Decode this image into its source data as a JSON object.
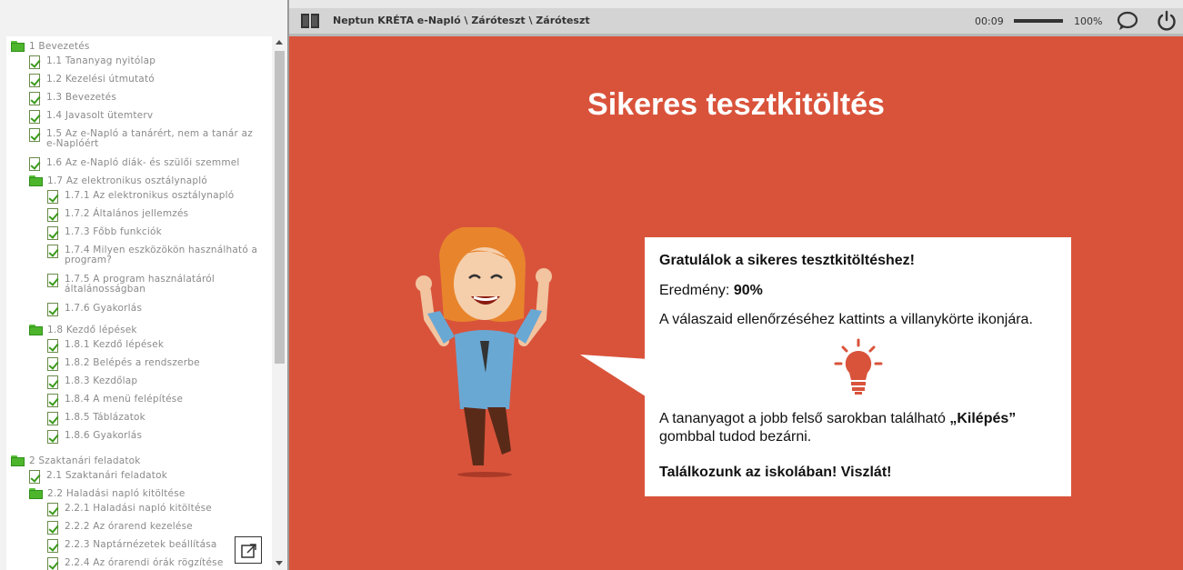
{
  "header": {
    "breadcrumb": "Neptun KRÉTA e-Napló \\ Záróteszt \\ Záróteszt",
    "time": "00:09",
    "volume_percent": "100%",
    "volume_level": 1.0
  },
  "toc": [
    {
      "label": "1 Bevezetés",
      "kind": "folder"
    },
    {
      "label": "1.1 Tananyag nyitólap",
      "kind": "check"
    },
    {
      "label": "1.2 Kezelési útmutató",
      "kind": "check"
    },
    {
      "label": "1.3 Bevezetés",
      "kind": "check"
    },
    {
      "label": "1.4 Javasolt ütemterv",
      "kind": "check"
    },
    {
      "label": "1.5 Az e-Napló a tanárért, nem a tanár az e-Naplóért",
      "kind": "check"
    },
    {
      "label": "1.6 Az e-Napló diák- és szülői szemmel",
      "kind": "check"
    },
    {
      "label": "1.7 Az elektronikus osztálynapló",
      "kind": "folder"
    },
    {
      "label": "1.7.1 Az elektronikus osztálynapló",
      "kind": "check"
    },
    {
      "label": "1.7.2 Általános jellemzés",
      "kind": "check"
    },
    {
      "label": "1.7.3 Főbb funkciók",
      "kind": "check"
    },
    {
      "label": "1.7.4 Milyen eszközökön használható a program?",
      "kind": "check"
    },
    {
      "label": "1.7.5 A program használatáról általánosságban",
      "kind": "check"
    },
    {
      "label": "1.7.6 Gyakorlás",
      "kind": "check"
    },
    {
      "label": "1.8 Kezdő lépések",
      "kind": "folder"
    },
    {
      "label": "1.8.1 Kezdő lépések",
      "kind": "check"
    },
    {
      "label": "1.8.2 Belépés a rendszerbe",
      "kind": "check"
    },
    {
      "label": "1.8.3 Kezdőlap",
      "kind": "check"
    },
    {
      "label": "1.8.4 A menü felépítése",
      "kind": "check"
    },
    {
      "label": "1.8.5 Táblázatok",
      "kind": "check"
    },
    {
      "label": "1.8.6 Gyakorlás",
      "kind": "check"
    },
    {
      "label": "2 Szaktanári feladatok",
      "kind": "folder"
    },
    {
      "label": "2.1 Szaktanári feladatok",
      "kind": "check"
    },
    {
      "label": "2.2 Haladási napló kitöltése",
      "kind": "folder"
    },
    {
      "label": "2.2.1 Haladási napló kitöltése",
      "kind": "check"
    },
    {
      "label": "2.2.2 Az órarend kezelése",
      "kind": "check"
    },
    {
      "label": "2.2.3 Naptárnézetek beállítása",
      "kind": "check"
    },
    {
      "label": "2.2.4 Az órarendi órák rögzítése",
      "kind": "check"
    }
  ],
  "slide": {
    "heading": "Sikeres tesztkitöltés",
    "congrats": "Gratulálok a sikeres tesztkitöltéshez!",
    "result_label": "Eredmény:",
    "result_value": "90%",
    "check_hint": "A válaszaid ellenőrzéséhez kattints a villanykörte ikonjára.",
    "exit_text_1": "A tananyagot a jobb felső sarokban található",
    "exit_button_name": "„Kilépés”",
    "exit_text_2": "gombbal tudod bezárni.",
    "farewell": "Találkozunk az iskolában! Viszlát!"
  },
  "colors": {
    "slide_bg": "#d9533b",
    "bulb": "#d9533b",
    "folder_green": "#4db52c"
  }
}
